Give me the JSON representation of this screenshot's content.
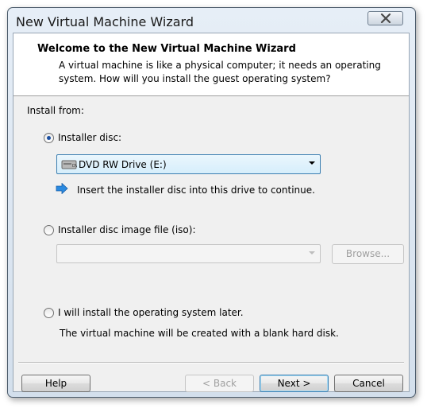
{
  "window": {
    "title": "New Virtual Machine Wizard"
  },
  "header": {
    "title": "Welcome to the New Virtual Machine Wizard",
    "description": "A virtual machine is like a physical computer; it needs an operating system. How will you install the guest operating system?"
  },
  "install_from": {
    "label": "Install from:",
    "options": [
      {
        "label": "Installer disc:",
        "selected": true
      },
      {
        "label": "Installer disc image file (iso):",
        "selected": false
      },
      {
        "label": "I will install the operating system later.",
        "selected": false
      }
    ],
    "disc_drive": {
      "value": "DVD RW Drive (E:)",
      "icon": "dvd-drive-icon"
    },
    "disc_hint": {
      "text": "Insert the installer disc into this drive to continue.",
      "icon": "blue-arrow-icon"
    },
    "iso_path": {
      "value": ""
    },
    "browse_label": "Browse...",
    "later_note": "The virtual machine will be created with a blank hard disk."
  },
  "buttons": {
    "help": "Help",
    "back": "< Back",
    "next": "Next >",
    "cancel": "Cancel"
  },
  "colors": {
    "accent": "#3c7fb1",
    "arrow": "#2b8ae0"
  }
}
